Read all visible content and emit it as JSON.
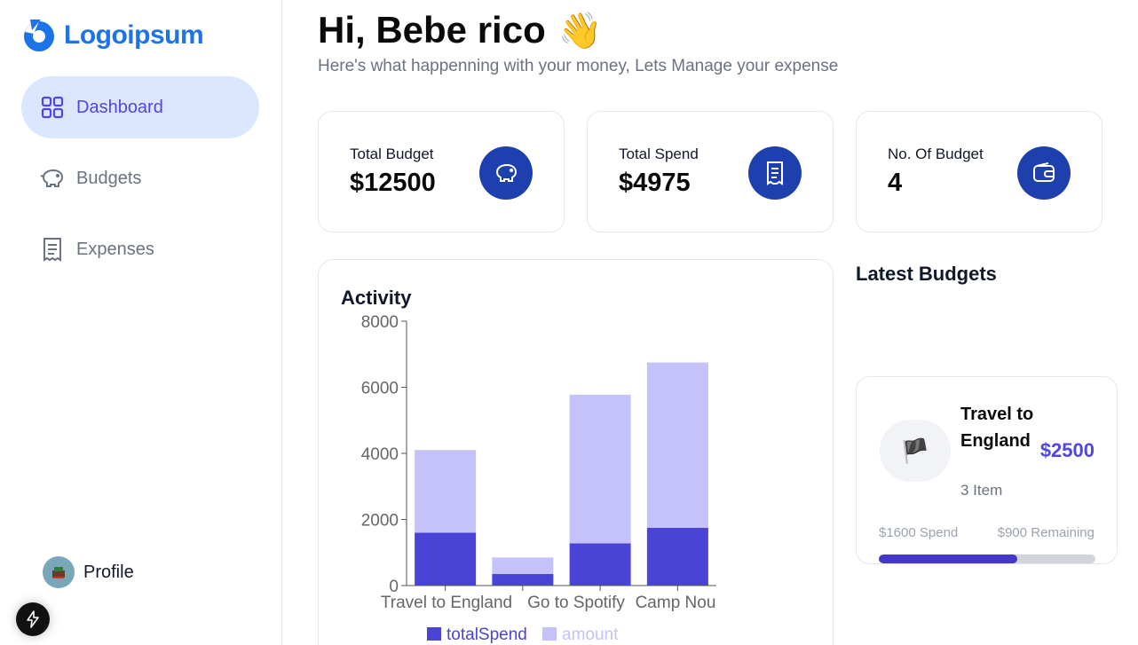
{
  "brand": {
    "name": "Logoipsum",
    "color": "#1d73e8"
  },
  "sidebar": {
    "items": [
      {
        "label": "Dashboard",
        "icon": "grid-icon",
        "active": true
      },
      {
        "label": "Budgets",
        "icon": "piggy-bank-icon",
        "active": false
      },
      {
        "label": "Expenses",
        "icon": "receipt-icon",
        "active": false
      }
    ],
    "profile": {
      "label": "Profile"
    }
  },
  "header": {
    "greeting": "Hi, Bebe rico",
    "wave": "👋",
    "subtitle": "Here's what happenning with your money, Lets Manage your expense"
  },
  "stats": [
    {
      "label": "Total Budget",
      "value": "$12500",
      "icon": "piggy-bank-icon"
    },
    {
      "label": "Total Spend",
      "value": "$4975",
      "icon": "receipt-icon"
    },
    {
      "label": "No. Of Budget",
      "value": "4",
      "icon": "wallet-icon"
    }
  ],
  "activity": {
    "title": "Activity"
  },
  "chart_data": {
    "type": "bar",
    "stacked": true,
    "categories": [
      "Travel to England",
      "Go to Spotify",
      "Camp Nou"
    ],
    "bar_count": 4,
    "bar_labels_visible": [
      "Travel to England",
      "Go to Spotify",
      "Camp Nou"
    ],
    "series": [
      {
        "name": "totalSpend",
        "color": "#4a44d6",
        "values": [
          1600,
          350,
          1275,
          1750
        ]
      },
      {
        "name": "amount",
        "color": "#c4c1fb",
        "values": [
          2500,
          500,
          4500,
          5000
        ]
      }
    ],
    "yticks": [
      "0",
      "2000",
      "4000",
      "6000",
      "8000"
    ],
    "ylim": [
      0,
      8000
    ],
    "legend_position": "bottom"
  },
  "latest": {
    "title": "Latest Budgets",
    "budget": {
      "emoji": "🏴",
      "name": "Travel to England",
      "items": "3 Item",
      "amount": "$2500",
      "spend": "$1600 Spend",
      "remaining": "$900 Remaining",
      "progress_fraction": 0.64
    }
  },
  "colors": {
    "accent": "#4f46e5",
    "iconBg": "#1e40af",
    "activeNavBg": "#dbe7fe"
  }
}
